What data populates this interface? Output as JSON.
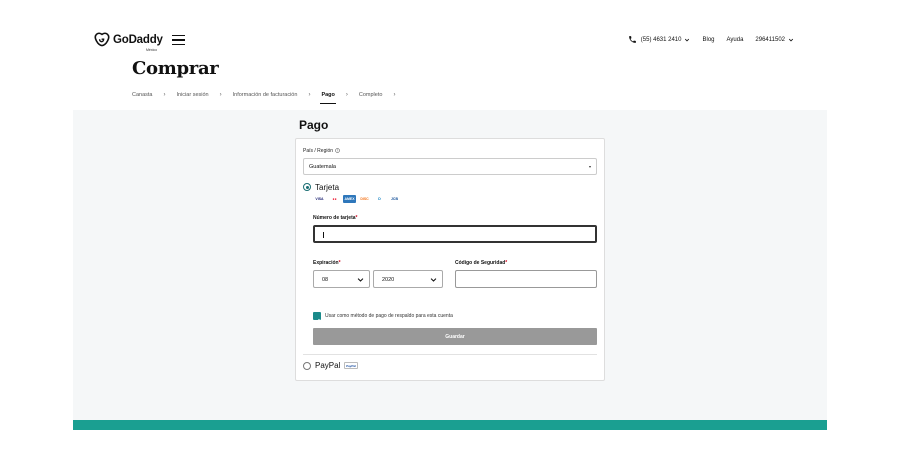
{
  "header": {
    "logo_text": "GoDaddy",
    "logo_country": "México",
    "phone": "(55) 4631 2410",
    "blog": "Blog",
    "help": "Ayuda",
    "account": "296411502"
  },
  "page_title": "Comprar",
  "breadcrumb": [
    {
      "label": "Canasta"
    },
    {
      "label": "Iniciar sesión"
    },
    {
      "label": "Información de facturación"
    },
    {
      "label": "Pago"
    },
    {
      "label": "Completo"
    }
  ],
  "breadcrumb_separator": "›",
  "payment": {
    "title": "Pago",
    "country_label": "País / Región",
    "country_value": "Guatemala",
    "card_option": "Tarjeta",
    "card_brands": [
      {
        "text": "VISA",
        "bg": "#ffffff",
        "fg": "#1a1f71"
      },
      {
        "text": "●●",
        "bg": "#ffffff",
        "fg": "#eb001b"
      },
      {
        "text": "AMEX",
        "bg": "#2e77bb",
        "fg": "#ffffff"
      },
      {
        "text": "DISC",
        "bg": "#ffffff",
        "fg": "#f47216"
      },
      {
        "text": "D",
        "bg": "#ffffff",
        "fg": "#0079be"
      },
      {
        "text": "JCB",
        "bg": "#ffffff",
        "fg": "#0e4c96"
      }
    ],
    "card_number_label": "Número de tarjeta",
    "card_number_value": "",
    "expiration_label": "Expiración",
    "exp_month": "08",
    "exp_year": "2020",
    "security_code_label": "Código de Seguridad",
    "security_code_value": "",
    "required_mark": "*",
    "backup_label": "Usar como método de pago de respaldo para esta cuenta",
    "save_button": "Guardar",
    "paypal_option": "PayPal",
    "paypal_mark": "PayPal"
  },
  "colors": {
    "accent": "#1a8a8a",
    "footer_band": "#1a9f91",
    "save_button_bg": "#999999"
  }
}
